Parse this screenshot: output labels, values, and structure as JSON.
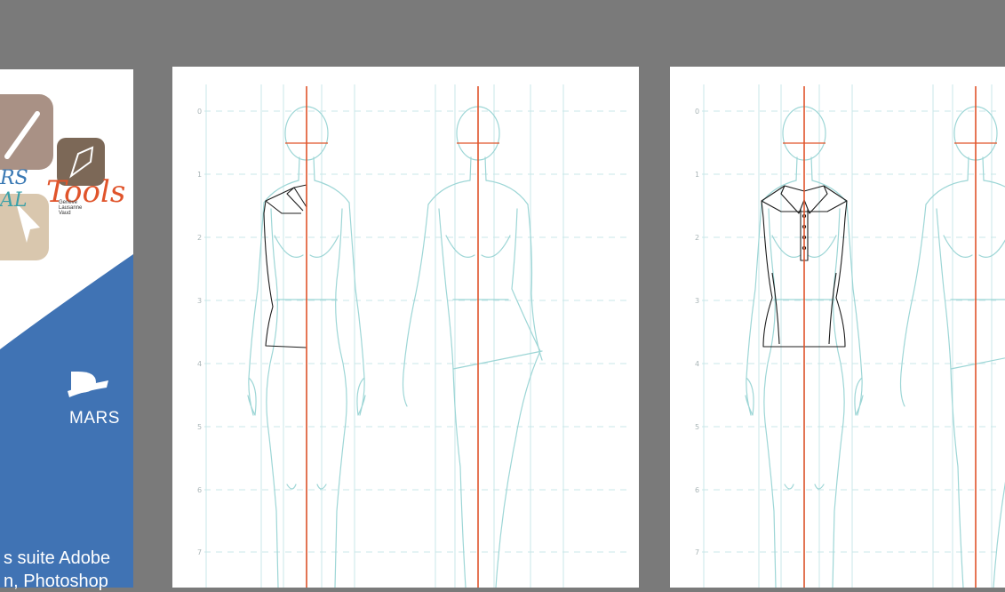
{
  "leaflet": {
    "logo": {
      "word1_partial": "RS",
      "word2_partial": "AL",
      "script_word": "Tools",
      "cities": [
        "Genève",
        "Lausanne",
        "Vaud"
      ]
    },
    "brand_label": "MARS",
    "text_line1": "s suite Adobe",
    "text_line2": "n, Photoshop"
  },
  "croquis": {
    "ruler_labels": [
      "0",
      "1",
      "2",
      "3",
      "4",
      "5",
      "6",
      "7"
    ]
  },
  "colors": {
    "workspace": "#7a7a7a",
    "leaflet_blue": "#4073b4",
    "figure_line": "#9dd6d6",
    "guide_line": "#c9e7e9",
    "center_line": "#e0542b",
    "garment_line": "#1c1c1c"
  }
}
